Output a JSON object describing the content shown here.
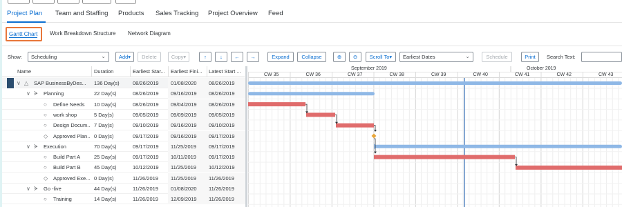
{
  "main_tabs": [
    "Project Plan",
    "Team and Staffing",
    "Products",
    "Sales Tracking",
    "Project Overview",
    "Feed"
  ],
  "sub_tabs": [
    "Gantt Chart",
    "Work Breakdown Structure",
    "Network Diagram"
  ],
  "toolbar": {
    "show_label": "Show:",
    "show_value": "Scheduling",
    "add": "Add",
    "delete": "Delete",
    "copy": "Copy",
    "expand": "Expand",
    "collapse": "Collapse",
    "scroll_to": "Scroll To",
    "scroll_target": "Earliest Dates",
    "schedule": "Schedule",
    "print": "Print",
    "search_label": "Search Text:",
    "search_value": ""
  },
  "columns": [
    "Name",
    "Duration",
    "Earliest Star...",
    "Earliest Fini...",
    "Latest Start ..."
  ],
  "rows": [
    {
      "name": "SAP BusinessByDes...",
      "duration": "136 Day(s)",
      "es": "08/26/2019",
      "ef": "01/08/2020",
      "ls": "08/26/2019",
      "icon": "triangle"
    },
    {
      "name": "Planning",
      "duration": "22 Day(s)",
      "es": "08/26/2019",
      "ef": "09/16/2019",
      "ls": "08/26/2019",
      "icon": "phase"
    },
    {
      "name": "Define Needs",
      "duration": "10 Day(s)",
      "es": "08/26/2019",
      "ef": "09/04/2019",
      "ls": "08/26/2019",
      "icon": "circle"
    },
    {
      "name": "work shop",
      "duration": "5 Day(s)",
      "es": "09/05/2019",
      "ef": "09/09/2019",
      "ls": "09/05/2019",
      "icon": "circle"
    },
    {
      "name": "Design Docum...",
      "duration": "7 Day(s)",
      "es": "09/10/2019",
      "ef": "09/16/2019",
      "ls": "09/10/2019",
      "icon": "circle"
    },
    {
      "name": "Approved Plan...",
      "duration": "0 Day(s)",
      "es": "09/17/2019",
      "ef": "09/16/2019",
      "ls": "09/17/2019",
      "icon": "diamond"
    },
    {
      "name": "Execution",
      "duration": "70 Day(s)",
      "es": "09/17/2019",
      "ef": "11/25/2019",
      "ls": "09/17/2019",
      "icon": "phase"
    },
    {
      "name": "Build Part A",
      "duration": "25 Day(s)",
      "es": "09/17/2019",
      "ef": "10/11/2019",
      "ls": "09/17/2019",
      "icon": "circle"
    },
    {
      "name": "Build Part B",
      "duration": "45 Day(s)",
      "es": "10/12/2019",
      "ef": "11/25/2019",
      "ls": "10/12/2019",
      "icon": "circle"
    },
    {
      "name": "Approved Exe...",
      "duration": "0 Day(s)",
      "es": "11/26/2019",
      "ef": "11/25/2019",
      "ls": "11/26/2019",
      "icon": "diamond"
    },
    {
      "name": "Go -live",
      "duration": "44 Day(s)",
      "es": "11/26/2019",
      "ef": "01/08/2020",
      "ls": "11/26/2019",
      "icon": "phase"
    },
    {
      "name": "Training",
      "duration": "14 Day(s)",
      "es": "11/26/2019",
      "ef": "12/09/2019",
      "ls": "11/26/2019",
      "icon": "circle"
    }
  ],
  "timeline": {
    "months": [
      "September 2019",
      "October 2019"
    ],
    "weeks": [
      "CW 35",
      "CW 36",
      "CW 37",
      "CW 38",
      "CW 39",
      "CW 40",
      "CW 41",
      "CW 42",
      "CW 43"
    ]
  },
  "colors": {
    "summary_bar": "#8fb8e6",
    "task_bar": "#e06c6c",
    "milestone": "#e8a63a",
    "today_line": "#5b8ac4",
    "accent": "#0a6ed1",
    "highlight": "#e8773a"
  }
}
